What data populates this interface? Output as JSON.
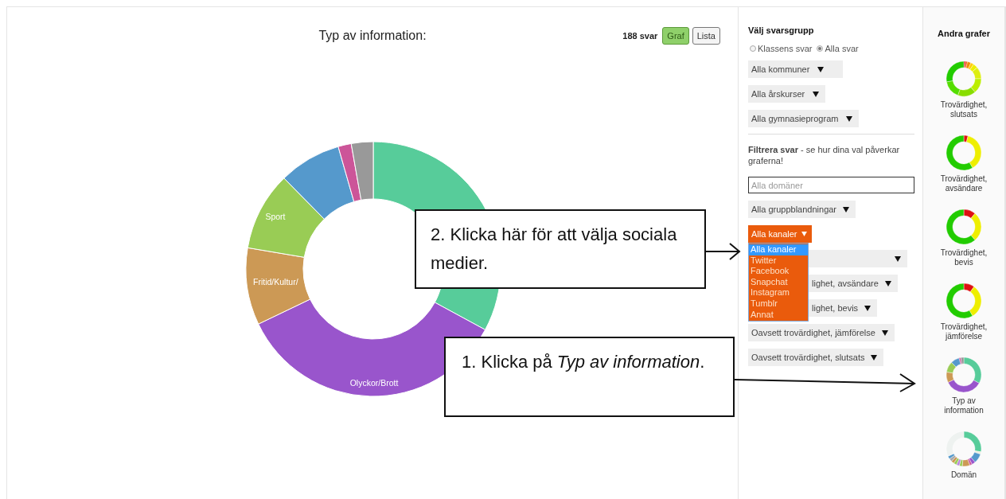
{
  "header": {
    "title": "Typ av information:",
    "count": "188 svar",
    "view_buttons": [
      {
        "label": "Graf",
        "selected": true
      },
      {
        "label": "Lista",
        "selected": false
      }
    ]
  },
  "chart_labels": [
    "Sport",
    "Fritid/Kultur/",
    "Olyckor/Brott"
  ],
  "filters": {
    "group_title": "Välj svarsgrupp",
    "radios": [
      {
        "label": "Klassens svar",
        "selected": false
      },
      {
        "label": "Alla svar",
        "selected": true
      }
    ],
    "group_selects": [
      "Alla kommuner",
      "Alla årskurser",
      "Alla gymnasieprogram"
    ],
    "filter_note": "**Filtrera svar** - se hur dina val påverkar graferna!",
    "domain_field": {
      "placeholder": "Alla domäner"
    },
    "selects": [
      {
        "kind": "plain",
        "value": "Alla gruppblandningar"
      },
      {
        "kind": "open",
        "value": "Alla kanaler",
        "options": [
          {
            "label": "Alla kanaler",
            "selected": true
          },
          {
            "label": "Twitter",
            "selected": false
          },
          {
            "label": "Facebook",
            "selected": false
          },
          {
            "label": "Snapchat",
            "selected": false
          },
          {
            "label": "Instagram",
            "selected": false
          },
          {
            "label": "Tumblr",
            "selected": false
          },
          {
            "label": "Annat",
            "selected": false
          }
        ]
      },
      {
        "kind": "covered"
      },
      {
        "kind": "partial",
        "value": "lighet, avsändare"
      },
      {
        "kind": "partial",
        "value": "lighet, bevis"
      },
      {
        "kind": "plain",
        "value": "Oavsett trovärdighet, jämförelse"
      },
      {
        "kind": "plain",
        "value": "Oavsett trovärdighet, slutsats"
      }
    ]
  },
  "other_graphs": {
    "title": "Andra grafer",
    "items": [
      {
        "label": "Trovärdighet, slutsats"
      },
      {
        "label": "Trovärdighet, avsändare"
      },
      {
        "label": "Trovärdighet, bevis"
      },
      {
        "label": "Trovärdighet, jämförelse"
      },
      {
        "label": "Typ av information"
      },
      {
        "label": "Domän"
      }
    ]
  },
  "callouts": [
    {
      "text": "2. Klicka här för att välja sociala medier."
    },
    {
      "text": "1. Klicka på *Typ av information*."
    }
  ]
}
